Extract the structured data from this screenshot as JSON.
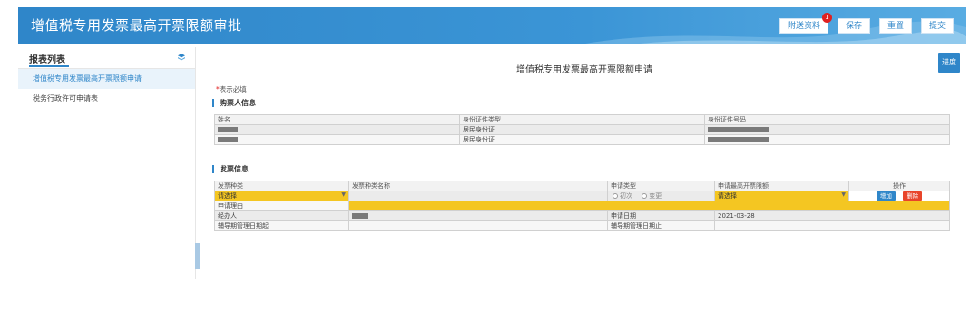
{
  "header": {
    "title": "增值税专用发票最高开票限额审批",
    "buttons": {
      "attachments": "附送资料",
      "attachments_badge": "1",
      "save": "保存",
      "reset": "重置",
      "submit": "提交"
    },
    "colors": {
      "primary": "#2f86c9",
      "badge": "#e02020"
    }
  },
  "sidebar": {
    "title": "报表列表",
    "icon": "layers-icon",
    "items": [
      {
        "label": "增值税专用发票最高开票限额申请",
        "active": true
      },
      {
        "label": "税务行政许可申请表",
        "active": false
      }
    ]
  },
  "main": {
    "form_title": "增值税专用发票最高开票限额申请",
    "progress_button": "进度",
    "required_note_star": "*",
    "required_note": "表示必填",
    "buyer_section": {
      "title": "购票人信息",
      "headers": [
        "姓名",
        "身份证件类型",
        "身份证件号码"
      ],
      "rows": [
        {
          "id_type": "居民身份证"
        },
        {
          "id_type": "居民身份证"
        }
      ]
    },
    "invoice_section": {
      "title": "发票信息",
      "headers": {
        "invoice_type": "发票种类",
        "invoice_type_name": "发票种类名称",
        "apply_type": "申请类型",
        "max_limit": "申请最高开票限额",
        "operation": "操作"
      },
      "row": {
        "invoice_type_select": "请选择",
        "apply_type_options": [
          "初次",
          "变更"
        ],
        "max_limit_select": "请选择",
        "add_button": "增加",
        "delete_button": "删除"
      },
      "reason_label": "申请理由",
      "handler_label": "经办人",
      "apply_date_label": "申请日期",
      "apply_date": "2021-03-28",
      "guide_start_label": "辅导期管理日期起",
      "guide_end_label": "辅导期管理日期止",
      "colors": {
        "required_field": "#f4c622",
        "delete": "#e8442a"
      }
    }
  }
}
